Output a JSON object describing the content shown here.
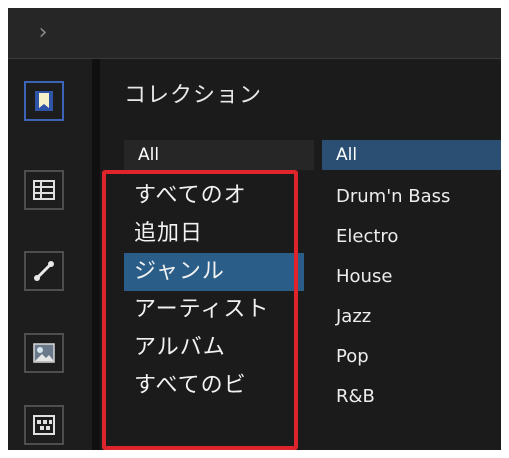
{
  "topbar": {
    "icon": "chevron-right-icon"
  },
  "sidebar": {
    "items": [
      {
        "icon": "bookmark-icon",
        "active": true
      },
      {
        "icon": "list-table-icon",
        "active": false
      },
      {
        "icon": "link-icon",
        "active": false
      },
      {
        "icon": "photo-icon",
        "active": false
      },
      {
        "icon": "grid-icon",
        "active": false
      }
    ]
  },
  "panel": {
    "title": "コレクション",
    "left_header": "All",
    "right_header": "All",
    "left_items": [
      "すべてのオ",
      "追加日",
      "ジャンル",
      "アーティスト",
      "アルバム",
      "すべてのビ"
    ],
    "left_selected_index": 2,
    "right_items": [
      "Drum'n Bass",
      "Electro",
      "House",
      "Jazz",
      "Pop",
      "R&B"
    ]
  },
  "colors": {
    "selection": "#2a5e88",
    "right_header": "#2b4f73",
    "highlight": "#e0242b"
  }
}
